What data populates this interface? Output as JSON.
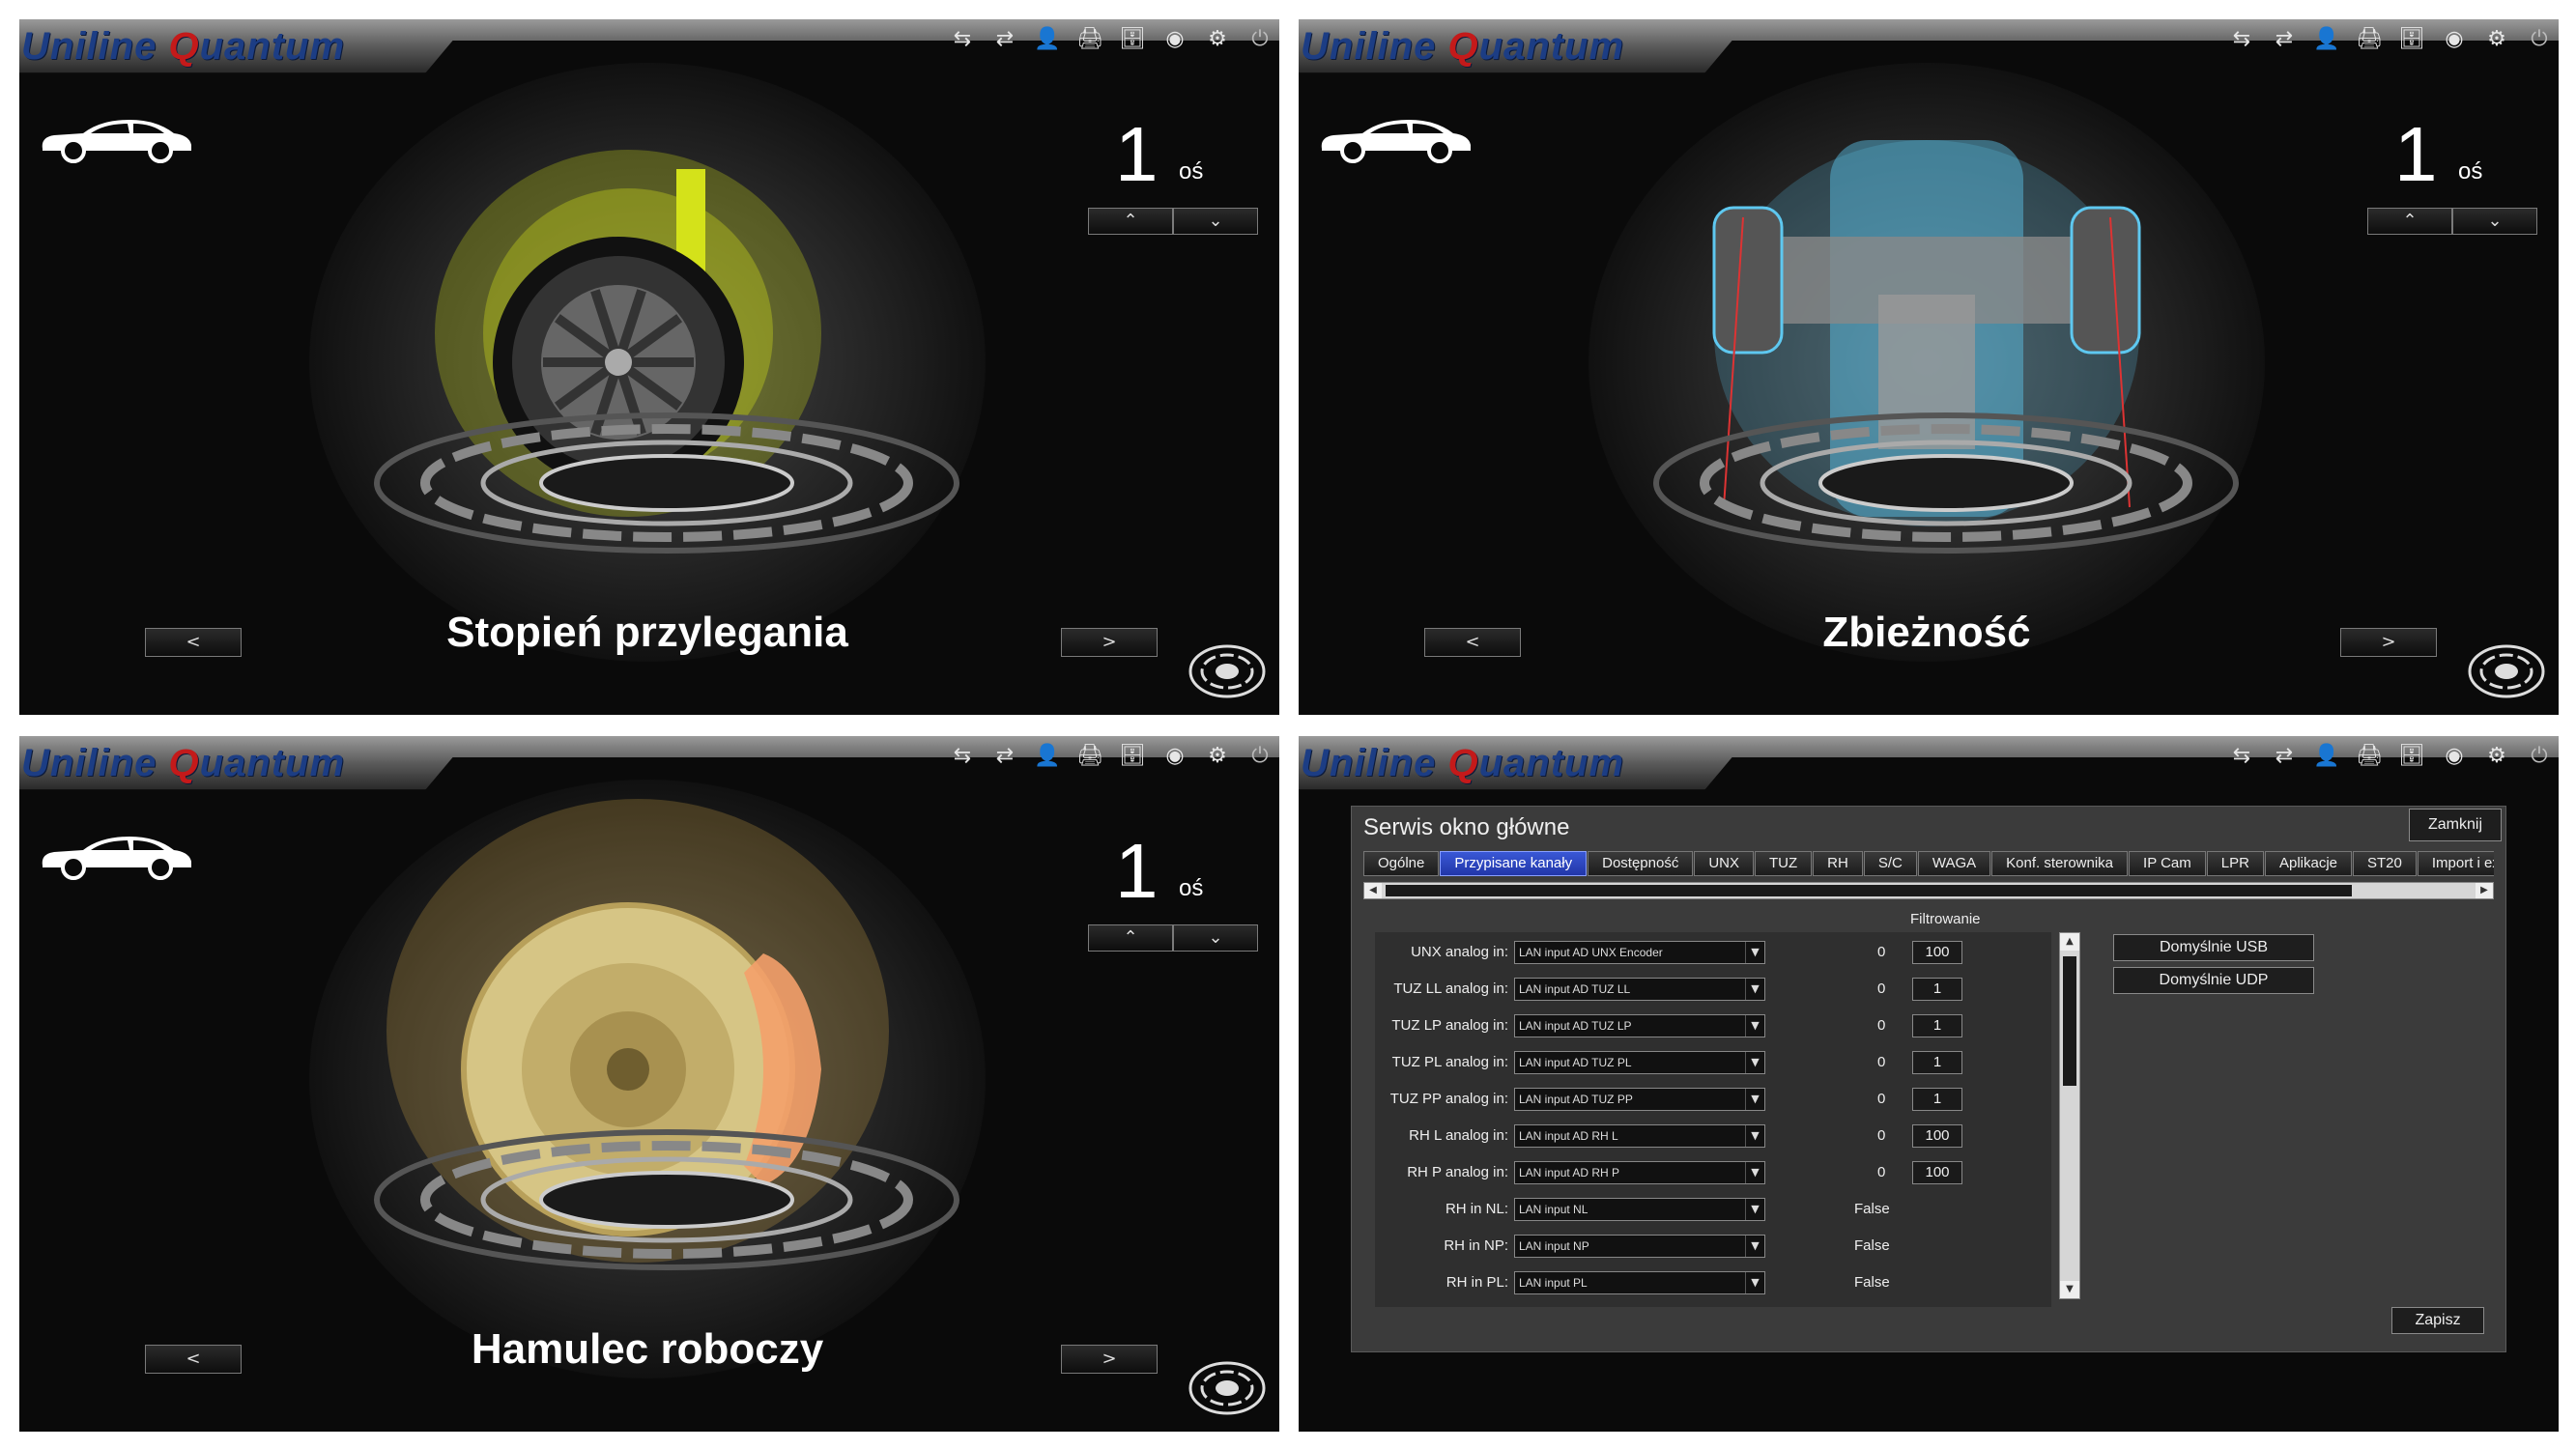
{
  "app": {
    "logo_a": "Uniline ",
    "logo_q": "Q",
    "logo_b": "uantum"
  },
  "toolbar": [
    "⇆",
    "⇄",
    "👤",
    "🖨",
    "🗄",
    "◉",
    "⚙",
    "⏻"
  ],
  "panels": [
    {
      "axle_number": "1",
      "axle_label": "oś",
      "up": "⌃",
      "down": "⌄",
      "prev": "<",
      "next": ">",
      "title": "Stopień przylegania",
      "theme": "#d4e21a"
    },
    {
      "axle_number": "1",
      "axle_label": "oś",
      "up": "⌃",
      "down": "⌄",
      "prev": "<",
      "next": ">",
      "title": "Zbieżność",
      "theme": "#5ec8f0"
    },
    {
      "axle_number": "1",
      "axle_label": "oś",
      "up": "⌃",
      "down": "⌄",
      "prev": "<",
      "next": ">",
      "title": "Hamulec roboczy",
      "theme": "#f2c14e"
    }
  ],
  "service": {
    "title": "Serwis okno główne",
    "close": "Zamknij",
    "tabs": [
      "Ogólne",
      "Przypisane kanały",
      "Dostępność",
      "UNX",
      "TUZ",
      "RH",
      "S/C",
      "WAGA",
      "Konf. sterownika",
      "IP Cam",
      "LPR",
      "Aplikacje",
      "ST20",
      "Import i expor"
    ],
    "active_tab": "Przypisane kanały",
    "filter_label": "Filtrowanie",
    "rows": [
      {
        "label": "UNX analog in:",
        "select": "LAN input AD UNX Encoder",
        "value": "0",
        "filter": "100"
      },
      {
        "label": "TUZ LL analog in:",
        "select": "LAN input AD TUZ LL",
        "value": "0",
        "filter": "1"
      },
      {
        "label": "TUZ LP analog in:",
        "select": "LAN input AD TUZ LP",
        "value": "0",
        "filter": "1"
      },
      {
        "label": "TUZ PL analog in:",
        "select": "LAN input AD TUZ PL",
        "value": "0",
        "filter": "1"
      },
      {
        "label": "TUZ PP analog in:",
        "select": "LAN input AD TUZ PP",
        "value": "0",
        "filter": "1"
      },
      {
        "label": "RH L analog in:",
        "select": "LAN input AD RH L",
        "value": "0",
        "filter": "100"
      },
      {
        "label": "RH P analog in:",
        "select": "LAN input AD RH P",
        "value": "0",
        "filter": "100"
      },
      {
        "label": "RH in NL:",
        "select": "LAN input NL",
        "value": "False",
        "filter": null
      },
      {
        "label": "RH in NP:",
        "select": "LAN input NP",
        "value": "False",
        "filter": null
      },
      {
        "label": "RH in PL:",
        "select": "LAN input PL",
        "value": "False",
        "filter": null
      }
    ],
    "default_usb": "Domyślnie USB",
    "default_udp": "Domyślnie UDP",
    "save": "Zapisz"
  },
  "colors": {
    "accent": "#2236a8",
    "logo": "#1c3d84",
    "logo_q": "#c41a1a"
  }
}
